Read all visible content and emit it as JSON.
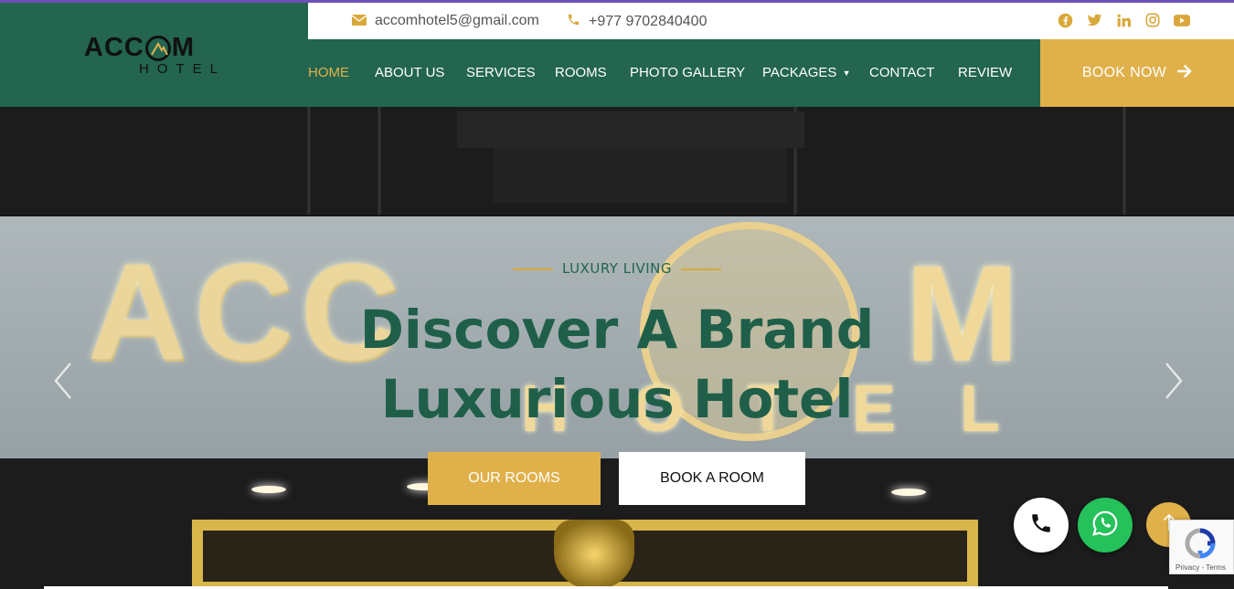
{
  "brand": {
    "logo_main_left": "ACC",
    "logo_main_right": "M",
    "logo_sub": "HOTEL"
  },
  "topbar": {
    "email": "accomhotel5@gmail.com",
    "phone": "+977 9702840400",
    "email_icon": "envelope-icon",
    "phone_icon": "phone-icon",
    "social": [
      "facebook-icon",
      "twitter-icon",
      "linkedin-icon",
      "instagram-icon",
      "youtube-icon"
    ]
  },
  "nav": {
    "items": [
      {
        "label": "HOME",
        "active": true
      },
      {
        "label": "ABOUT US"
      },
      {
        "label": "SERVICES"
      },
      {
        "label": "ROOMS"
      },
      {
        "label": "PHOTO GALLERY"
      },
      {
        "label": "PACKAGES"
      },
      {
        "label": "CONTACT"
      },
      {
        "label": "REVIEW"
      }
    ],
    "book_now": "BOOK NOW"
  },
  "hero": {
    "tagline": "LUXURY LIVING",
    "headline_line1": "Discover A Brand",
    "headline_line2": "Luxurious Hotel",
    "primary_button": "OUR ROOMS",
    "secondary_button": "BOOK A ROOM",
    "sign_letters": "ACC",
    "sign_m": "M",
    "sign_hotel": "HOTEL"
  },
  "recaptcha": {
    "links": "Privacy - Terms"
  },
  "colors": {
    "brand_green": "#23654f",
    "accent_gold": "#e0b04a",
    "whatsapp_green": "#25c15a"
  }
}
